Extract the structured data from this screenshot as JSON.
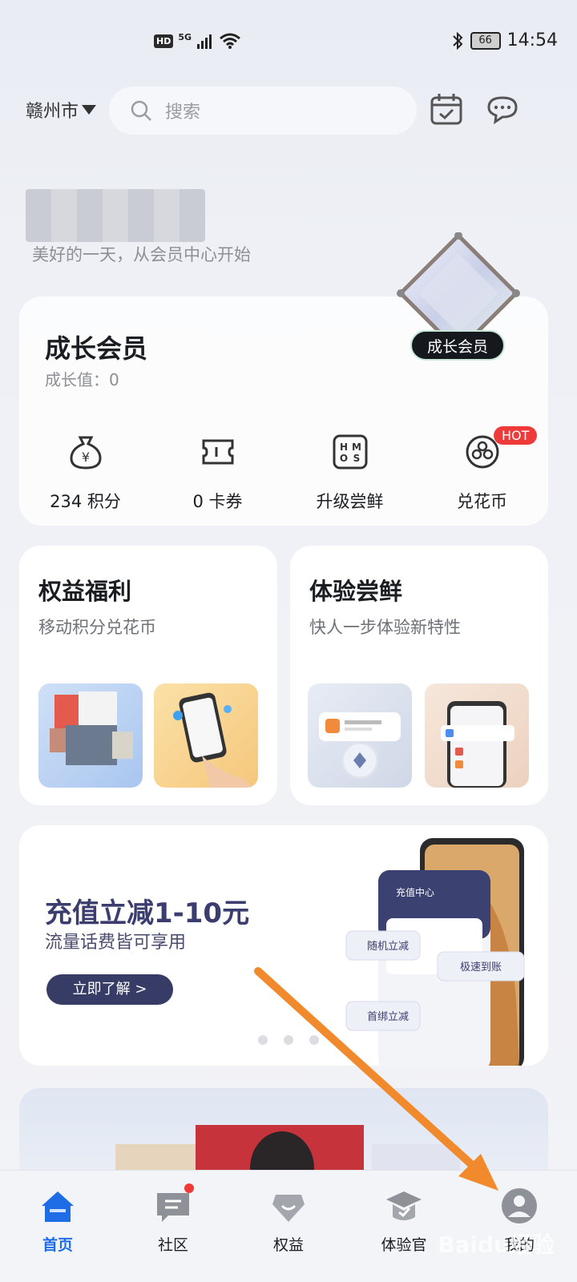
{
  "status_bar": {
    "hd": "HD",
    "network": "5G",
    "battery": "66",
    "time": "14:54"
  },
  "top": {
    "city": "赣州市",
    "search_placeholder": "搜索"
  },
  "profile": {
    "welcome": "美好的一天，从会员中心开始"
  },
  "member": {
    "title": "成长会员",
    "growth_label": "成长值：0",
    "badge": "成长会员",
    "shortcuts": [
      {
        "label": "234 积分",
        "icon": "money-bag-icon"
      },
      {
        "label": "0 卡券",
        "icon": "ticket-icon"
      },
      {
        "label": "升级尝鲜",
        "icon": "hmos-icon"
      },
      {
        "label": "兑花币",
        "icon": "flower-coin-icon",
        "badge": "HOT"
      }
    ]
  },
  "features": [
    {
      "title": "权益福利",
      "subtitle": "移动积分兑花币"
    },
    {
      "title": "体验尝鲜",
      "subtitle": "快人一步体验新特性"
    }
  ],
  "banner": {
    "headline": "充值立减1-10元",
    "desc": "流量话费皆可享用",
    "cta": "立即了解 >",
    "phone_title": "充值中心",
    "tags": [
      "随机立减",
      "极速到账",
      "首绑立减"
    ]
  },
  "bottom_nav": [
    {
      "label": "首页",
      "active": true
    },
    {
      "label": "社区",
      "active": false
    },
    {
      "label": "权益",
      "active": false
    },
    {
      "label": "体验官",
      "active": false
    },
    {
      "label": "我的",
      "active": false
    }
  ],
  "colors": {
    "accent": "#1f6de6",
    "hot": "#ef3a3a",
    "banner_text": "#3b3d6e",
    "annotation_arrow": "#f08a2c"
  },
  "watermark": "Baidu经验"
}
